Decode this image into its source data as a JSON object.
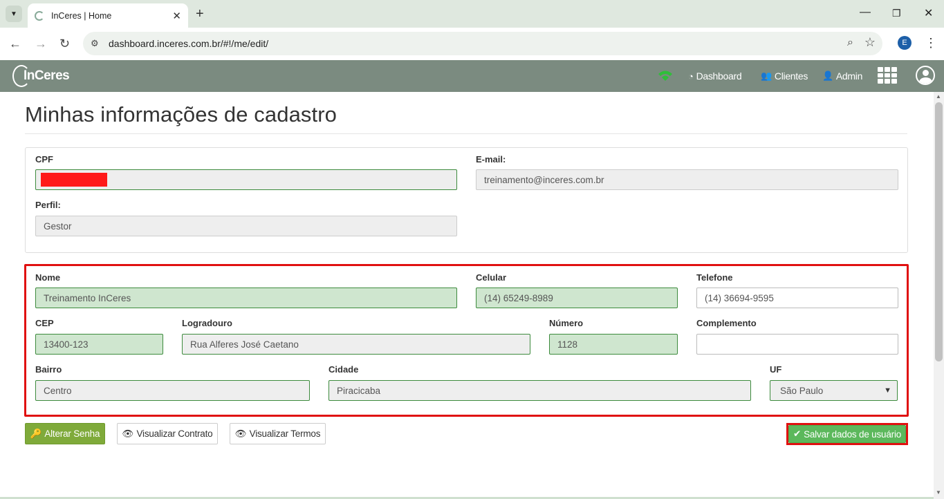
{
  "browser": {
    "tab_title": "InCeres | Home",
    "url": "dashboard.inceres.com.br/#!/me/edit/",
    "profile_initial": "E"
  },
  "header": {
    "logo_text": "InCeres",
    "nav": [
      {
        "label": "Dashboard",
        "icon": "dashboard-icon"
      },
      {
        "label": "Clientes",
        "icon": "users-icon"
      },
      {
        "label": "Admin",
        "icon": "user-plus-icon"
      }
    ],
    "accent_color": "#7b8b80"
  },
  "page": {
    "title": "Minhas informações de cadastro"
  },
  "account": {
    "cpf_label": "CPF",
    "cpf_value": "",
    "email_label": "E-mail:",
    "email_value": "treinamento@inceres.com.br",
    "perfil_label": "Perfil:",
    "perfil_value": "Gestor"
  },
  "personal": {
    "nome_label": "Nome",
    "nome_value": "Treinamento InCeres",
    "celular_label": "Celular",
    "celular_value": "(14) 65249-8989",
    "telefone_label": "Telefone",
    "telefone_value": "(14) 36694-9595",
    "cep_label": "CEP",
    "cep_value": "13400-123",
    "logradouro_label": "Logradouro",
    "logradouro_value": "Rua Alferes José Caetano",
    "numero_label": "Número",
    "numero_value": "1128",
    "complemento_label": "Complemento",
    "complemento_value": "",
    "bairro_label": "Bairro",
    "bairro_value": "Centro",
    "cidade_label": "Cidade",
    "cidade_value": "Piracicaba",
    "uf_label": "UF",
    "uf_value": "São Paulo"
  },
  "actions": {
    "alterar_senha": "Alterar Senha",
    "visualizar_contrato": "Visualizar Contrato",
    "visualizar_termos": "Visualizar Termos",
    "salvar": "Salvar dados de usuário"
  }
}
